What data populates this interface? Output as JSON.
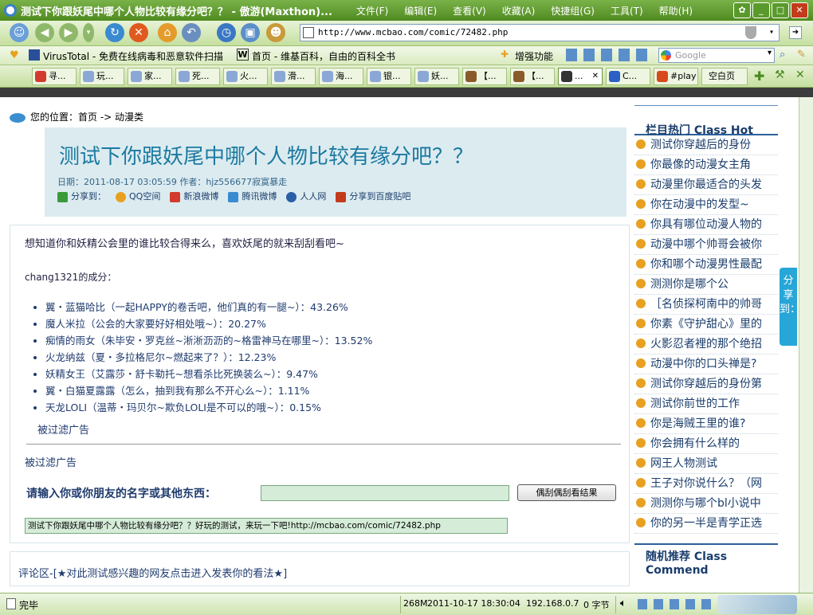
{
  "window": {
    "title": "测试下你跟妖尾中哪个人物比较有缘分吧？？ - 傲游(Maxthon)...",
    "menu": [
      "文件(F)",
      "编辑(E)",
      "查看(V)",
      "收藏(A)",
      "快捷组(G)",
      "工具(T)",
      "帮助(H)"
    ]
  },
  "address": {
    "url": "http://www.mcbao.com/comic/72482.php"
  },
  "favorites": {
    "virustotal": "VirusTotal - 免费在线病毒和恶意软件扫描",
    "wiki": "首页 - 维基百科，自由的百科全书",
    "enhance": "增强功能",
    "search_placeholder": "Google"
  },
  "tabs": [
    {
      "label": "寻...",
      "color": "#d23b2e"
    },
    {
      "label": "玩...",
      "color": "#8aa7d6"
    },
    {
      "label": "家...",
      "color": "#8aa7d6"
    },
    {
      "label": "死...",
      "color": "#8aa7d6"
    },
    {
      "label": "火...",
      "color": "#8aa7d6"
    },
    {
      "label": "滑...",
      "color": "#8aa7d6"
    },
    {
      "label": "海...",
      "color": "#8aa7d6"
    },
    {
      "label": "银...",
      "color": "#8aa7d6"
    },
    {
      "label": "妖...",
      "color": "#8aa7d6"
    },
    {
      "label": "【...",
      "color": "#8a5a2a"
    },
    {
      "label": "【...",
      "color": "#8a5a2a"
    },
    {
      "label": "...",
      "color": "#333333",
      "active": true
    },
    {
      "label": "C...",
      "color": "#2b5fc4"
    },
    {
      "label": "#play",
      "color": "#d84a1a"
    },
    {
      "label": "空白页",
      "color": "#ffffff"
    }
  ],
  "page": {
    "breadcrumb": "您的位置：首页 -> 动漫类",
    "title": "测试下你跟妖尾中哪个人物比较有缘分吧？？",
    "meta": "日期：2011-08-17 03:05:59 作者：hjz556677寂寞暴走",
    "share": {
      "label": "分享到：",
      "qq": "QQ空间",
      "sina": "新浪微博",
      "tencent": "腾讯微博",
      "renren": "人人网",
      "baidu": "分享到百度贴吧"
    },
    "intro": "想知道你和妖精公会里的谁比较合得来么，喜欢妖尾的就来刮刮看吧~",
    "who": "chang1321的成分：",
    "results": [
      "翼・蓝猫哈比（一起HAPPY的卷舌吧，他们真的有一腿~）：43.26%",
      "魔人米拉（公会的大家要好好相处哦~）：20.27%",
      "痴情的雨女（朱毕安・罗克丝~淅淅沥沥的~格雷神马在哪里~）：13.52%",
      "火龙纳兹（夏・多拉格尼尔~燃起来了？）：12.23%",
      "妖精女王（艾露莎・舒卡勒托~想看杀比死换装么~）：9.47%",
      "翼・白猫夏露露（怎么，抽到我有那么不开心么~）：1.11%",
      "天龙LOLI（温蒂・玛贝尔~欺负LOLI是不可以的哦~）：0.15%"
    ],
    "filtered1": "被过滤广告",
    "filtered2": "被过滤广告",
    "prompt": "请输入你或你朋友的名字或其他东西：",
    "button": "偶刮偶刮看结果",
    "sharetext": "测试下你跟妖尾中哪个人物比较有缘分吧？？好玩的测试，来玩一下吧!http://mcbao.com/comic/72482.php",
    "comment": "评论区-[★对此测试感兴趣的网友点击进入发表你的看法★]"
  },
  "sidebar": {
    "hot_title": "栏目热门  Class Hot",
    "hot_items": [
      "测试你穿越后的身份",
      "你最像的动漫女主角",
      "动漫里你最适合的头发",
      "你在动漫中的发型~",
      "你具有哪位动漫人物的",
      "动漫中哪个帅哥会被你",
      "你和哪个动漫男性最配",
      "测测你是哪个公",
      "［名侦探柯南中的帅哥",
      "你素《守护甜心》里的",
      "火影忍者裡的那个绝招",
      "动漫中你的口头禅是?",
      "测试你穿越后的身份第",
      "测试你前世的工作",
      "你是海贼王里的谁?",
      "你会拥有什么样的",
      "网王人物测试",
      "王子对你说什么？（网",
      "测测你与哪个bl小说中",
      "你的另一半是青学正选"
    ],
    "random_title": "随机推荐  Class Commend"
  },
  "floatshare": "分享到：",
  "status": {
    "left": "完毕",
    "memory": "268M",
    "datetime": "2011-10-17 18:30:04",
    "ip": "192.168.0.7",
    "bytes": "0 字节"
  }
}
